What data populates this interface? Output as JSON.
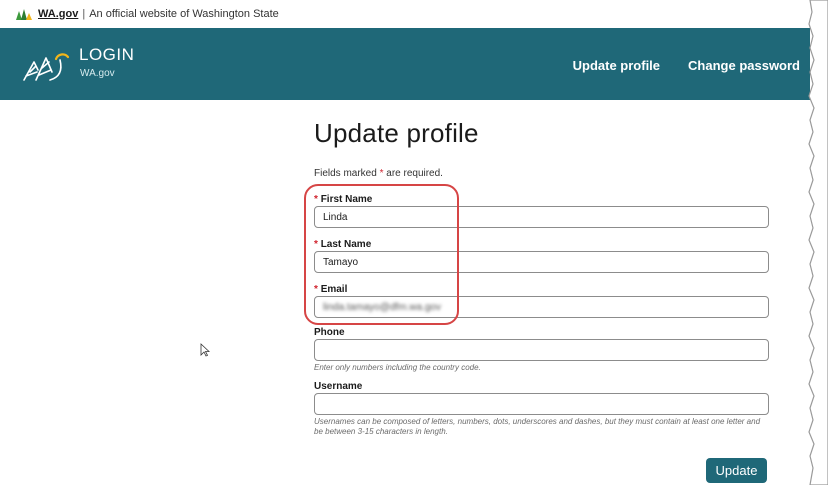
{
  "gov_banner": {
    "site_link": "WA.gov",
    "separator": "|",
    "text": "An official website of Washington State"
  },
  "header": {
    "logo_title": "LOGIN",
    "logo_subtitle": "WA.gov",
    "nav": [
      "Update profile",
      "Change password"
    ]
  },
  "form": {
    "title": "Update profile",
    "required_note_before": "Fields marked ",
    "required_note_star": "*",
    "required_note_after": " are required.",
    "first_name": {
      "required_star": "*",
      "label": "First Name",
      "value": "Linda"
    },
    "last_name": {
      "required_star": "*",
      "label": "Last Name",
      "value": "Tamayo"
    },
    "email": {
      "required_star": "*",
      "label": "Email",
      "value": "linda.tamayo@dfm.wa.gov"
    },
    "phone": {
      "label": "Phone",
      "value": "",
      "hint": "Enter only numbers including the country code."
    },
    "username": {
      "label": "Username",
      "value": "",
      "hint": "Usernames can be composed of letters, numbers, dots, underscores and dashes, but they must contain at least one letter and be between 3-15 characters in length."
    },
    "submit_label": "Update"
  },
  "colors": {
    "header_bg": "#1f6878",
    "required": "#d1242f",
    "highlight": "#d64545"
  }
}
